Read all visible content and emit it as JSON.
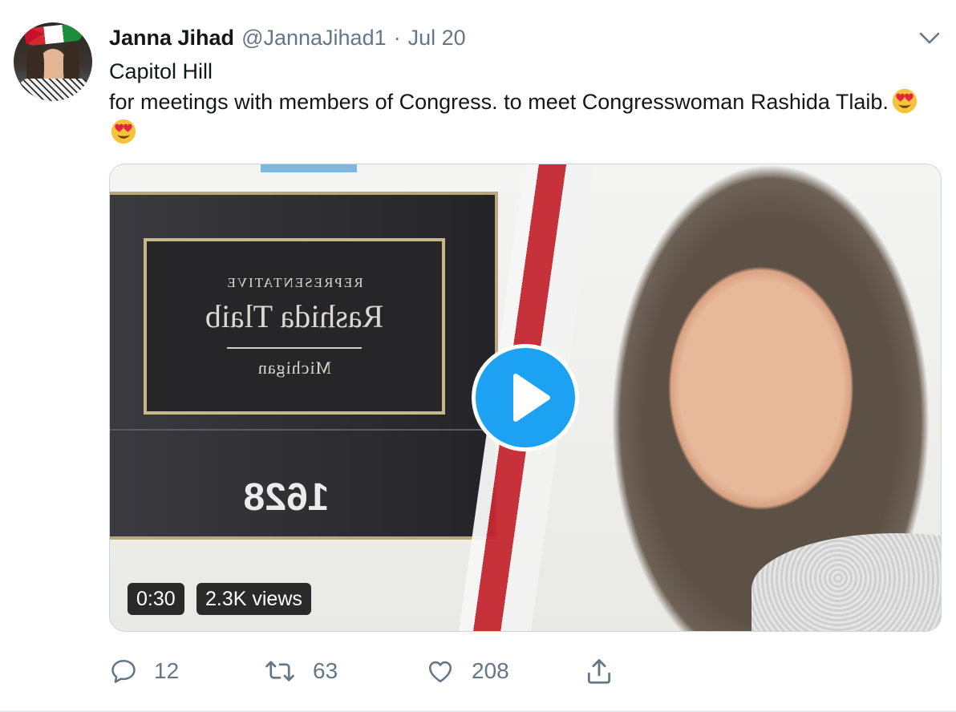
{
  "user": {
    "name": "Janna Jihad",
    "handle": "@JannaJihad1",
    "separator": "·",
    "date": "Jul 20"
  },
  "tweet": {
    "line1": "Capitol Hill",
    "line2": "for meetings with members of Congress. to meet Congresswoman Rashida Tlaib.",
    "emoji": [
      "smiling-face-with-heart-eyes",
      "smiling-face-with-heart-eyes"
    ]
  },
  "media": {
    "type": "video",
    "duration": "0:30",
    "views": "2.3K views",
    "sign": {
      "title": "REPRESENTATIVE",
      "name": "Rashida Tlaib",
      "state": "Michigan",
      "room": "1628"
    },
    "play_color": "#1da1f2"
  },
  "actions": {
    "replies": "12",
    "retweets": "63",
    "likes": "208",
    "icons": [
      "reply-icon",
      "retweet-icon",
      "like-icon",
      "share-icon"
    ]
  },
  "colors": {
    "text": "#14171a",
    "secondary": "#657786",
    "accent": "#1da1f2"
  }
}
